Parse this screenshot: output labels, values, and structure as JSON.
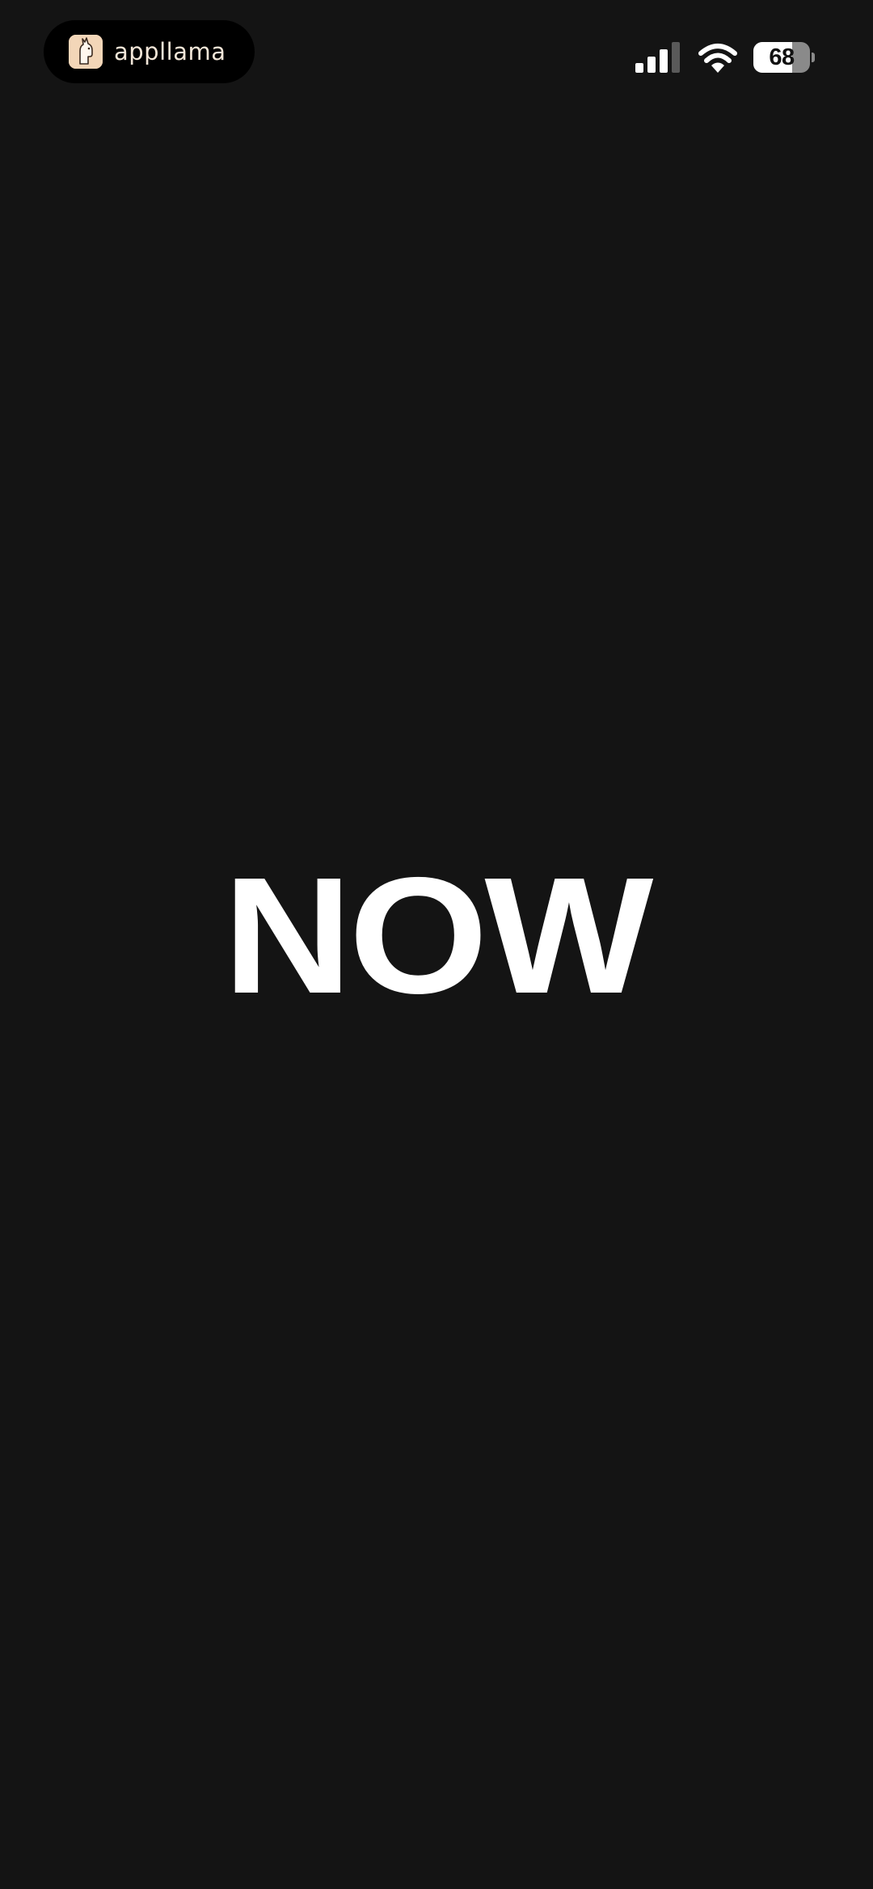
{
  "status_bar": {
    "app_name": "appllama",
    "app_logo_icon": "llama-logo-icon",
    "signal_icon": "cellular-signal-icon",
    "wifi_icon": "wifi-icon",
    "battery_level": "68",
    "battery_fraction": 0.68
  },
  "main": {
    "headline": "NOW"
  },
  "colors": {
    "background": "#141414",
    "text": "#ffffff",
    "pill": "#000000",
    "logo_bg": "#f3d6b8"
  }
}
